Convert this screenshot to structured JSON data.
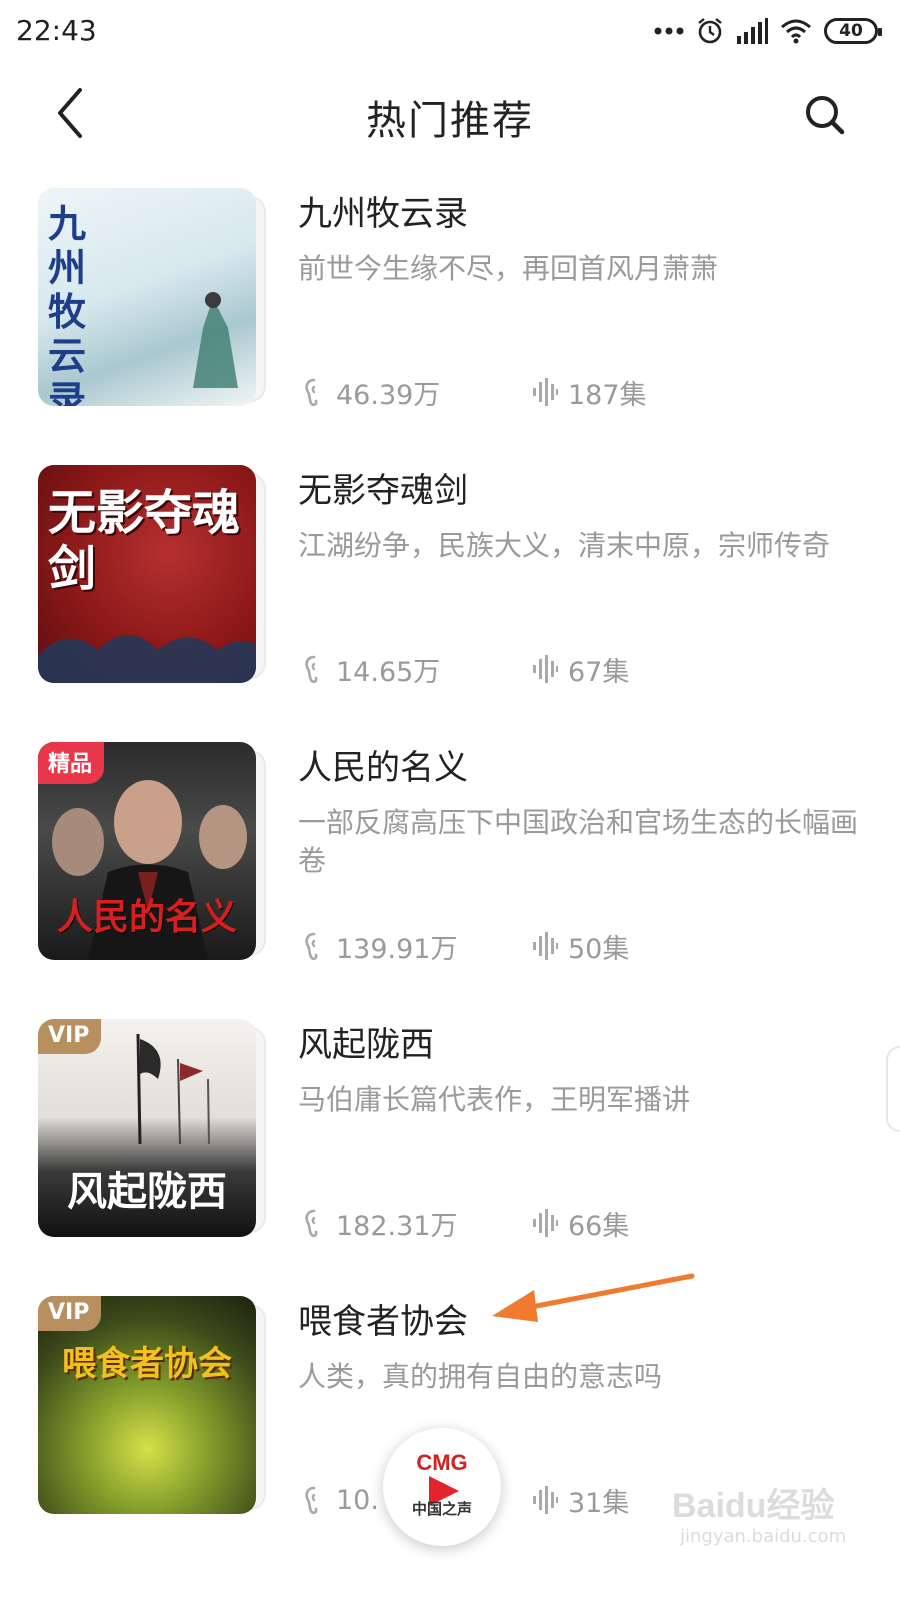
{
  "status_bar": {
    "time": "22:43",
    "battery": "40",
    "icons": [
      "more-dots-icon",
      "alarm-icon",
      "signal-icon",
      "wifi-icon",
      "battery-icon"
    ]
  },
  "header": {
    "title": "热门推荐",
    "back_icon": "chevron-left-icon",
    "search_icon": "search-icon"
  },
  "items": [
    {
      "title": "九州牧云录",
      "description": "前世今生缘不尽，再回首风月萧萧",
      "plays": "46.39万",
      "episodes": "187集",
      "badge": "",
      "cover_text": "九州牧云录"
    },
    {
      "title": "无影夺魂剑",
      "description": "江湖纷争，民族大义，清末中原，宗师传奇",
      "plays": "14.65万",
      "episodes": "67集",
      "badge": "",
      "cover_text": "无影夺魂剑"
    },
    {
      "title": "人民的名义",
      "description": "一部反腐高压下中国政治和官场生态的长幅画卷",
      "plays": "139.91万",
      "episodes": "50集",
      "badge": "精品",
      "cover_text": "人民的名义"
    },
    {
      "title": "风起陇西",
      "description": "马伯庸长篇代表作，王明军播讲",
      "plays": "182.31万",
      "episodes": "66集",
      "badge": "VIP",
      "cover_text": "风起陇西"
    },
    {
      "title": "喂食者协会",
      "description": "人类，真的拥有自由的意志吗",
      "plays": "10.",
      "episodes": "31集",
      "badge": "VIP",
      "cover_text": "喂食者协会"
    }
  ],
  "player": {
    "brand": "CMG",
    "station": "中国之声"
  },
  "watermark": {
    "main": "Baidu经验",
    "sub": "jingyan.baidu.com"
  },
  "colors": {
    "title_text": "#222222",
    "secondary_text": "#9a9a9a",
    "badge_jingpin": "#e8364a",
    "badge_vip": "#b89060",
    "annotation_arrow": "#f07a30"
  }
}
